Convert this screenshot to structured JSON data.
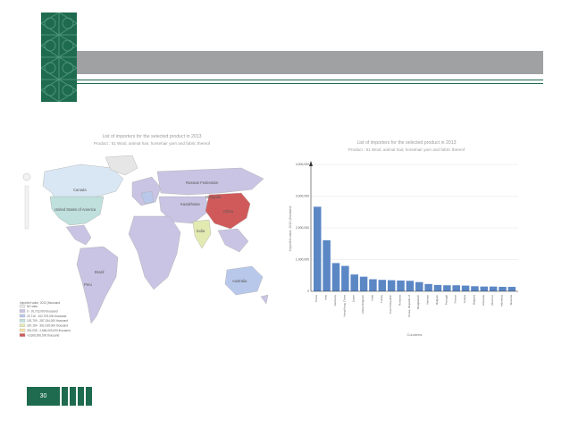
{
  "slide": {
    "page_number": "30",
    "colors": {
      "header_bar": "#a0a1a3",
      "accent_green": "#1e6b4f",
      "bar_blue": "#5b87c5",
      "china_red": "#d05a5a"
    }
  },
  "map": {
    "title": "List of importers for the selected product in 2013",
    "subtitle": "Product : 51 Wool, animal hair, horsehair yarn and fabric thereof",
    "labels": {
      "canada": "Canada",
      "usa": "United States of America",
      "brazil": "Brazil",
      "russia": "Russian Federation",
      "china": "China",
      "india": "India",
      "australia": "Australia",
      "mongolia": "Mongolia",
      "peru": "Peru",
      "kazakhstan": "Kazakhstan"
    },
    "legend": {
      "title": "Imported value, 2013 (thousand",
      "items": [
        {
          "label": "NO data",
          "color": "#e6e6e6"
        },
        {
          "label": "0 - 20,716,000 thousand",
          "color": "#c9c4e3"
        },
        {
          "label": "20,716 - 102,709,000 thousand",
          "color": "#b8c8ea"
        },
        {
          "label": "102,709 - 287,154,000 thousand",
          "color": "#bfe0dd"
        },
        {
          "label": "287,154 - 391,035,000 thousand",
          "color": "#e2eab2"
        },
        {
          "label": "391,035 - 2,666,000,000 thousand",
          "color": "#f3dfa0"
        },
        {
          "label": ">2,666,000,000 thousand",
          "color": "#d05a5a"
        }
      ]
    }
  },
  "chart_data": {
    "type": "bar",
    "title": "List of importers for the selected product in 2013",
    "subtitle": "Product : 51 Wool, animal hair, horsehair yarn and fabric thereof",
    "xlabel": "Countries",
    "ylabel": "Imported value, 2013 (thousand",
    "ylim": [
      0,
      4000000
    ],
    "yticks": [
      "4,000,000",
      "3,000,000",
      "2,000,000",
      "1,000,000",
      "0"
    ],
    "categories": [
      "China",
      "Italy",
      "Germany",
      "Hong Kong, China",
      "Japan",
      "United Kingdom",
      "India",
      "Turkey",
      "Czech Republic",
      "Romania",
      "Korea, Republic of",
      "Bangladesh",
      "Vietnam",
      "Belgium",
      "Portugal",
      "France",
      "Tunisia",
      "Bulgaria",
      "Lithuania",
      "Morocco",
      "Indonesia",
      "Slovenia"
    ],
    "values": [
      2666000,
      1610000,
      890000,
      800000,
      530000,
      460000,
      380000,
      360000,
      350000,
      340000,
      330000,
      290000,
      230000,
      200000,
      190000,
      190000,
      180000,
      160000,
      150000,
      150000,
      140000,
      140000
    ]
  }
}
